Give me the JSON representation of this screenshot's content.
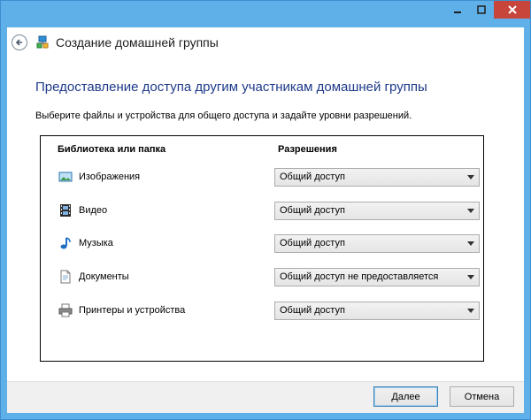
{
  "window": {
    "title": "Создание домашней группы"
  },
  "heading": "Предоставление доступа другим участникам домашней группы",
  "description": "Выберите файлы и устройства для общего доступа и задайте уровни разрешений.",
  "table": {
    "col_library": "Библиотека или папка",
    "col_permissions": "Разрешения",
    "rows": [
      {
        "label": "Изображения",
        "icon": "pictures-icon",
        "permission": "Общий доступ"
      },
      {
        "label": "Видео",
        "icon": "video-icon",
        "permission": "Общий доступ"
      },
      {
        "label": "Музыка",
        "icon": "music-icon",
        "permission": "Общий доступ"
      },
      {
        "label": "Документы",
        "icon": "documents-icon",
        "permission": "Общий доступ не предоставляется"
      },
      {
        "label": "Принтеры и устройства",
        "icon": "printer-icon",
        "permission": "Общий доступ"
      }
    ]
  },
  "buttons": {
    "next": "Далее",
    "cancel": "Отмена"
  },
  "colors": {
    "frame": "#5fb0e8",
    "close": "#c7453b",
    "heading": "#1e3a8a"
  }
}
